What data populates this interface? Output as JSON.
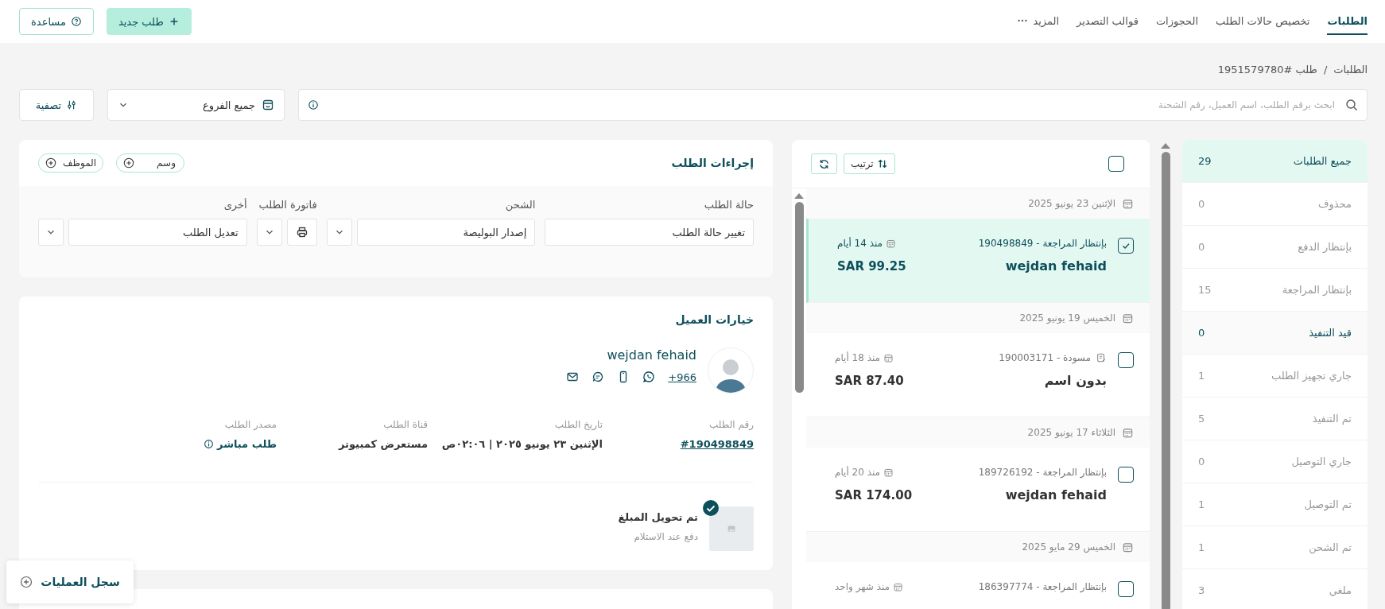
{
  "nav": {
    "tabs": [
      {
        "label": "الطلبات",
        "selected": true
      },
      {
        "label": "تخصيص حالات الطلب",
        "selected": false
      },
      {
        "label": "الحجوزات",
        "selected": false
      },
      {
        "label": "قوالب التصدير",
        "selected": false
      }
    ],
    "more_label": "المزيد"
  },
  "header_buttons": [
    {
      "kind": "primary",
      "label": "طلب جديد"
    },
    {
      "kind": "outline",
      "label": "مساعدة"
    }
  ],
  "breadcrumb": {
    "items": [
      "الطلبات",
      "طلب #1951579780"
    ],
    "separator": "/"
  },
  "search": {
    "placeholder": "ابحث برقم الطلب، اسم العميل، رقم الشحنة"
  },
  "branch_select": {
    "value": "جميع الفروع"
  },
  "filter_button": {
    "label": "تصفية"
  },
  "status_list": [
    {
      "label": "جميع الطلبات",
      "count": "29",
      "selected": true,
      "hovered": false
    },
    {
      "label": "محذوف",
      "count": "0",
      "selected": false,
      "hovered": false
    },
    {
      "label": "بإنتظار الدفع",
      "count": "0",
      "selected": false,
      "hovered": false
    },
    {
      "label": "بإنتظار المراجعة",
      "count": "15",
      "selected": false,
      "hovered": false
    },
    {
      "label": "قيد التنفيذ",
      "count": "0",
      "selected": false,
      "hovered": true
    },
    {
      "label": "جاري تجهيز الطلب",
      "count": "1",
      "selected": false,
      "hovered": false
    },
    {
      "label": "تم التنفيذ",
      "count": "5",
      "selected": false,
      "hovered": false
    },
    {
      "label": "جاري التوصيل",
      "count": "0",
      "selected": false,
      "hovered": false
    },
    {
      "label": "تم التوصيل",
      "count": "1",
      "selected": false,
      "hovered": false
    },
    {
      "label": "تم الشحن",
      "count": "1",
      "selected": false,
      "hovered": false
    },
    {
      "label": "ملغي",
      "count": "3",
      "selected": false,
      "hovered": false
    }
  ],
  "orders_panel": {
    "select_all_checked": false,
    "sort_label": "ترتيب",
    "groups": [
      {
        "date": "الإثنين 23 يونيو 2025",
        "orders": [
          {
            "kind": "review",
            "reference": "بإنتظار المراجعة - 190498849",
            "age": "منذ 14 أيام",
            "name": "wejdan fehaid",
            "amount": "SAR 99.25",
            "checked": true,
            "selected": true
          }
        ]
      },
      {
        "date": "الخميس 19 يونيو 2025",
        "orders": [
          {
            "kind": "draft",
            "reference": "مسودة  -  190003171",
            "age": "منذ 18 أيام",
            "name": "بدون اسم",
            "amount": "SAR 87.40",
            "checked": false,
            "selected": false
          }
        ]
      },
      {
        "date": "الثلاثاء 17 يونيو 2025",
        "orders": [
          {
            "kind": "review",
            "reference": "بإنتظار المراجعة - 189726192",
            "age": "منذ 20 أيام",
            "name": "wejdan fehaid",
            "amount": "SAR 174.00",
            "checked": false,
            "selected": false
          }
        ]
      },
      {
        "date": "الخميس 29 مايو 2025",
        "orders": [
          {
            "kind": "review",
            "reference": "بإنتظار المراجعة - 186397774",
            "age": "منذ شهر واحد",
            "checked": false,
            "selected": false
          }
        ]
      }
    ]
  },
  "actions_panel": {
    "title": "إجراءات الطلب",
    "tag_buttons": [
      "وسم",
      "الموظف"
    ],
    "groups": [
      {
        "kind": "select",
        "label": "حالة الطلب",
        "value": "تغيير حالة الطلب"
      },
      {
        "kind": "split",
        "label": "الشحن",
        "value": "إصدار البوليصة"
      },
      {
        "kind": "print",
        "label": "فاتورة الطلب"
      },
      {
        "kind": "split",
        "label": "أخرى",
        "value": "تعديل الطلب"
      }
    ]
  },
  "customer_panel": {
    "title": "خيارات العميل",
    "name": "wejdan fehaid",
    "phone": "+966",
    "details": [
      {
        "kind": "link",
        "label": "رقم الطلب",
        "value": "#190498849"
      },
      {
        "kind": "text",
        "label": "تاريخ الطلب",
        "value": "الإثنين ٢٣ يونيو ٢٠٢٥ | ٠٢:٠٦ص"
      },
      {
        "kind": "text",
        "label": "قناة الطلب",
        "value": "مستعرض كمبيوتر"
      },
      {
        "kind": "info",
        "label": "مصدر الطلب",
        "value": "طلب مباشر"
      }
    ],
    "payment": {
      "title": "تم تحويل المبلغ",
      "subtitle": "دفع عند الاستلام",
      "confirmed": true
    }
  },
  "activity_log_button": {
    "label": "سجل العمليات"
  }
}
